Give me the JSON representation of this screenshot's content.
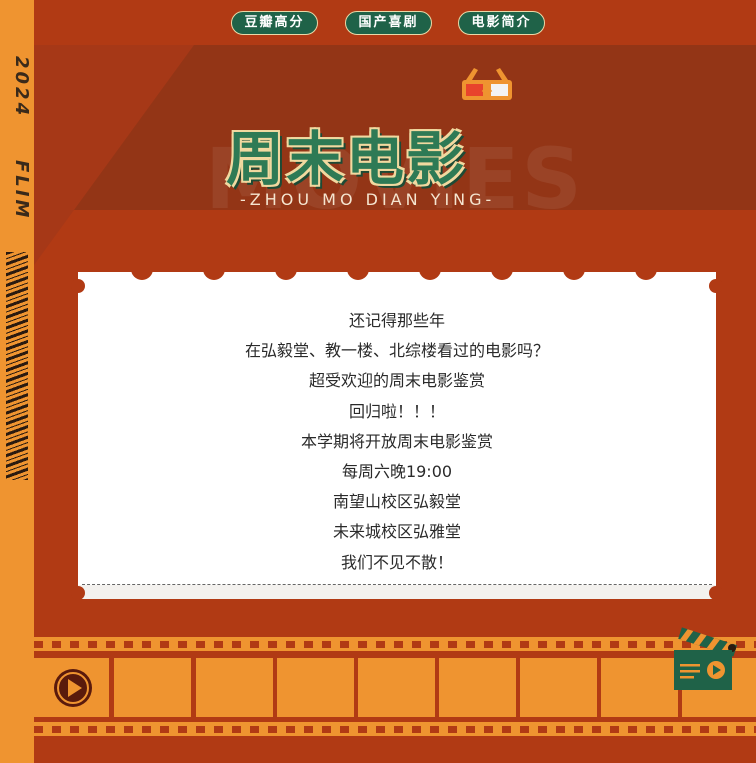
{
  "nav": {
    "items": [
      {
        "label": "豆瓣高分"
      },
      {
        "label": "国产喜剧"
      },
      {
        "label": "电影简介"
      }
    ]
  },
  "strip": {
    "year": "2024",
    "word": "FLIM"
  },
  "header": {
    "title": "周末电影",
    "subtitle": "-ZHOU MO DIAN YING-",
    "watermark": "MOVIES"
  },
  "card": {
    "lines": [
      "还记得那些年",
      "在弘毅堂、教一楼、北综楼看过的电影吗？",
      "超受欢迎的周末电影鉴赏",
      "回归啦！！！",
      "本学期将开放周末电影鉴赏",
      "每周六晚19:00",
      "南望山校区弘毅堂",
      "未来城校区弘雅堂",
      "我们不见不散！"
    ]
  },
  "colors": {
    "background": "#b13a14",
    "accent_orange": "#ef9430",
    "brand_green": "#1f6248",
    "card": "#ffffff"
  },
  "icons": {
    "glasses": "3d-glasses-icon",
    "play": "play-icon",
    "clapper": "clapperboard-icon"
  }
}
